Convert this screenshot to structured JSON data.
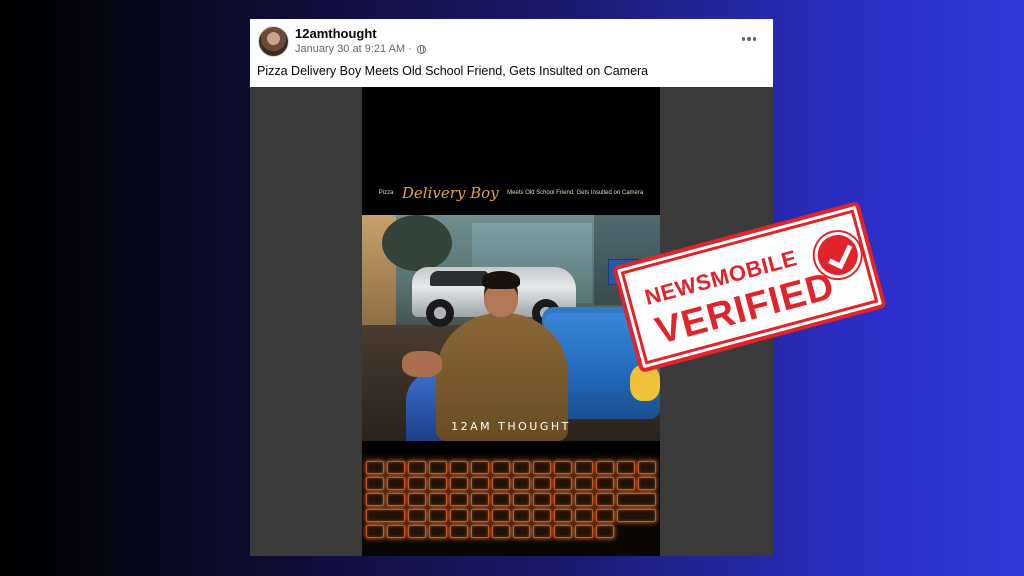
{
  "post": {
    "author": "12amthought",
    "timestamp": "January 30 at 9:21 AM",
    "separator": "·",
    "privacy_icon": "globe-icon",
    "more_icon": "more-options-icon",
    "caption": "Pizza Delivery Boy Meets Old School Friend, Gets Insulted on Camera"
  },
  "video": {
    "title_prefix": "Pizza",
    "title_script": "Delivery Boy",
    "title_suffix": "Meets Old School Friend, Gets Insulted on Camera",
    "watermark": "12AM THOUGHT"
  },
  "stamp": {
    "line1": "NEWSMOBILE",
    "line2": "VERIFIED",
    "icon": "checkmark-icon",
    "color": "#e0242a"
  },
  "colors": {
    "background_left": "#000000",
    "background_right": "#3138d4",
    "keyboard_glow": "#e66e28"
  }
}
